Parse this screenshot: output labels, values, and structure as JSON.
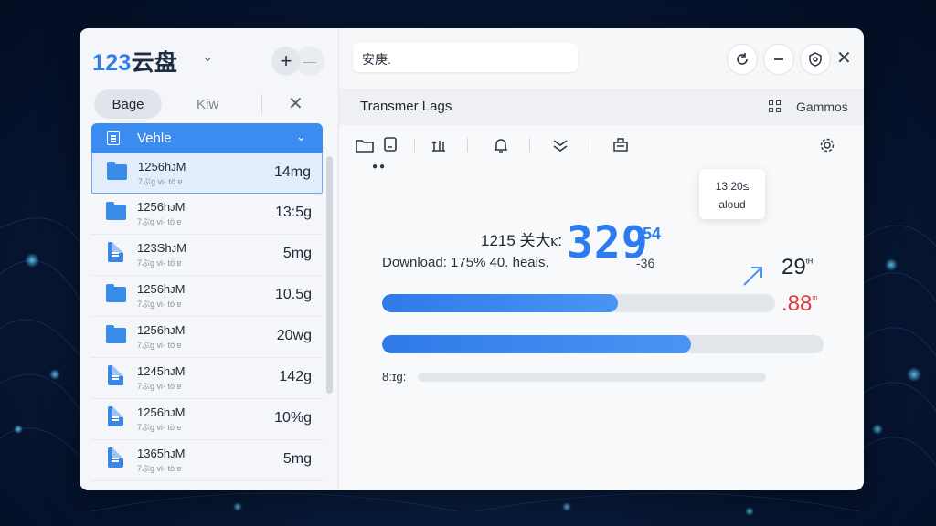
{
  "app": {
    "brand_num": "123",
    "brand_name": "云盘",
    "brand_caret": "⌄",
    "plus": "+",
    "more": "—"
  },
  "left_tabs": {
    "active": "Bage",
    "second": "Kiw",
    "close": "✕"
  },
  "list": {
    "header_title": "Vehle",
    "header_caret": "⌄",
    "rows": [
      {
        "name": "1256hᴊM",
        "sub": "7ぷg vi· tö ɐ",
        "size": "14mg",
        "icon": "folder-icon",
        "selected": true
      },
      {
        "name": "1256hᴊM",
        "sub": "7ぷg vi· tö ɐ",
        "size": "13:5g",
        "icon": "folder-icon"
      },
      {
        "name": "123ShᴊM",
        "sub": "7ぷg vi· tö ɐ",
        "size": "5mg",
        "icon": "file-icon"
      },
      {
        "name": "1256hᴊM",
        "sub": "7ぷg vi· tö ɐ",
        "size": "10.5g",
        "icon": "folder-icon"
      },
      {
        "name": "1256hᴊM",
        "sub": "7ぷg vi· tö ɐ",
        "size": "20wg",
        "icon": "folder-icon"
      },
      {
        "name": "1245hᴊM",
        "sub": "7ぷg vi· tö ɐ",
        "size": "142g",
        "icon": "file-icon"
      },
      {
        "name": "1256hᴊM",
        "sub": "7ぷg vi· tö ɐ",
        "size": "10%g",
        "icon": "file-icon"
      },
      {
        "name": "1365hᴊM",
        "sub": "7ぷg vi· tö ɐ",
        "size": "5mg",
        "icon": "file-icon"
      }
    ]
  },
  "search": {
    "value": "安庚."
  },
  "section": {
    "title": "Transmer Lags",
    "grid_label": "Gammos"
  },
  "tooltip": {
    "line1": "13:20≤",
    "line2": "aloud"
  },
  "stats": {
    "label": "1215 关大ⲕ:",
    "big_number": "329",
    "big_sup": "54",
    "big_sub": "-36",
    "download_text": "Download: 175% 40. heais.",
    "right_value": "29",
    "right_value_sup": "ᵗᴴ",
    "right_red": ".88",
    "right_red_sup": "ᵐ",
    "bar1_progress": 0.6,
    "bar2_progress": 0.7,
    "bar3_label": "8ːɪg:"
  },
  "colors": {
    "accent": "#2f7ae8",
    "red": "#e03a3a"
  }
}
